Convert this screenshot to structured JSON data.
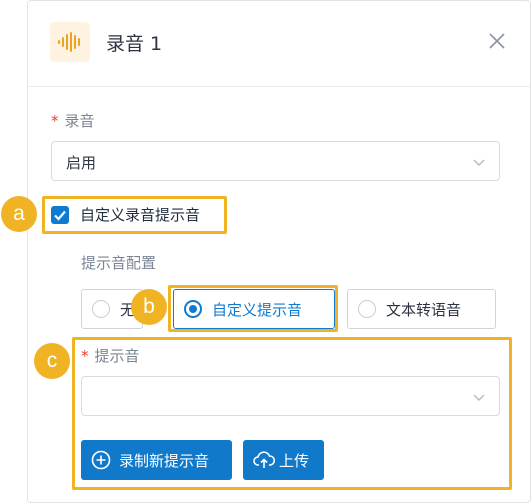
{
  "header": {
    "title": "录音 1",
    "icon": "audio-waveform-icon"
  },
  "recording": {
    "label": "录音",
    "value": "启用"
  },
  "custom_prompt_checkbox": {
    "label": "自定义录音提示音",
    "checked": true
  },
  "prompt_config": {
    "label": "提示音配置",
    "options": [
      {
        "label": "无",
        "selected": false
      },
      {
        "label": "自定义提示音",
        "selected": true
      },
      {
        "label": "文本转语音",
        "selected": false
      }
    ]
  },
  "prompt_sound": {
    "label": "提示音",
    "value": ""
  },
  "actions": {
    "record_label": "录制新提示音",
    "upload_label": "上传"
  },
  "callouts": [
    "a",
    "b",
    "c"
  ],
  "colors": {
    "accent": "#0f7bd0",
    "highlight": "#f0b323",
    "required": "#e5412d"
  }
}
